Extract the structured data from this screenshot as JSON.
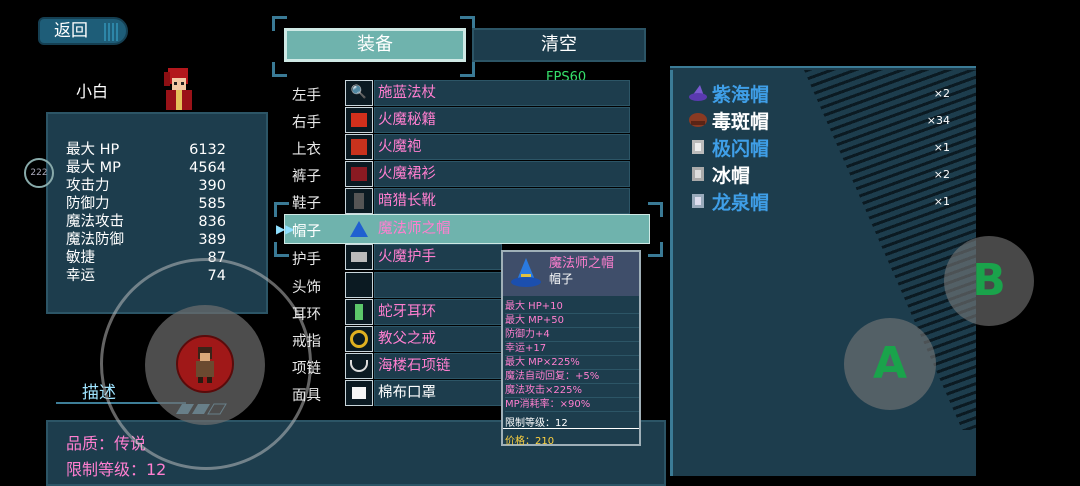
{
  "back_label": "返回",
  "character": {
    "name": "小白",
    "stats": [
      {
        "label": "最大 HP",
        "value": "6132"
      },
      {
        "label": "最大 MP",
        "value": "4564"
      },
      {
        "label": "攻击力",
        "value": "390"
      },
      {
        "label": "防御力",
        "value": "585"
      },
      {
        "label": "魔法攻击",
        "value": "836"
      },
      {
        "label": "魔法防御",
        "value": "389"
      },
      {
        "label": "敏捷",
        "value": "87"
      },
      {
        "label": "幸运",
        "value": "74"
      }
    ],
    "side_circle_label": "222"
  },
  "tabs": {
    "equip": "装备",
    "clear": "清空"
  },
  "fps": "FPS60",
  "slots": [
    {
      "slot": "左手",
      "item": "施蓝法杖",
      "color": "#ff7fd0",
      "icon": "staff-icon"
    },
    {
      "slot": "右手",
      "item": "火魔秘籍",
      "color": "#ff7fd0",
      "icon": "book-icon"
    },
    {
      "slot": "上衣",
      "item": "火魔袍",
      "color": "#ff7fd0",
      "icon": "robe-icon"
    },
    {
      "slot": "裤子",
      "item": "火魔裙衫",
      "color": "#ff7fd0",
      "icon": "skirt-icon"
    },
    {
      "slot": "鞋子",
      "item": "暗猎长靴",
      "color": "#ff7fd0",
      "icon": "boots-icon"
    },
    {
      "slot": "帽子",
      "item": "魔法师之帽",
      "color": "#ff7fd0",
      "icon": "wizard-hat-icon"
    },
    {
      "slot": "护手",
      "item": "火魔护手",
      "color": "#ff7fd0",
      "icon": "gauntlet-icon"
    },
    {
      "slot": "头饰",
      "item": "",
      "color": "#ffffff",
      "icon": ""
    },
    {
      "slot": "耳环",
      "item": "蛇牙耳环",
      "color": "#ff7fd0",
      "icon": "earring-icon"
    },
    {
      "slot": "戒指",
      "item": "教父之戒",
      "color": "#ff7fd0",
      "icon": "ring-icon"
    },
    {
      "slot": "项链",
      "item": "海楼石项链",
      "color": "#ff7fd0",
      "icon": "necklace-icon"
    },
    {
      "slot": "面具",
      "item": "棉布口罩",
      "color": "#ffffff",
      "icon": "mask-icon"
    }
  ],
  "selected_slot_index": 5,
  "tooltip": {
    "name": "魔法师之帽",
    "type": "帽子",
    "stats": [
      "最大 HP+10",
      "最大 MP+50",
      "防御力+4",
      "幸运+17",
      "最大 MP×225%",
      "魔法自动回复：+5%",
      "魔法攻击×225%",
      "MP消耗率：×90%"
    ],
    "level": "限制等级：12",
    "price": "价格：210"
  },
  "inventory": [
    {
      "name": "紫海帽",
      "qty": "×2",
      "color": "#3f9fe8",
      "icon": "purple-hat-icon"
    },
    {
      "name": "毒斑帽",
      "qty": "×34",
      "color": "#ffffff",
      "icon": "poison-hat-icon"
    },
    {
      "name": "极闪帽",
      "qty": "×1",
      "color": "#3f9fe8",
      "icon": "flash-hat-icon"
    },
    {
      "name": "冰帽",
      "qty": "×2",
      "color": "#ffffff",
      "icon": "ice-hat-icon"
    },
    {
      "name": "龙泉帽",
      "qty": "×1",
      "color": "#3f9fe8",
      "icon": "dragon-hat-icon"
    }
  ],
  "description": {
    "label": "描述",
    "quality": "品质：传说",
    "level": "限制等级：12"
  },
  "buttons": {
    "a": "A",
    "b": "B"
  }
}
